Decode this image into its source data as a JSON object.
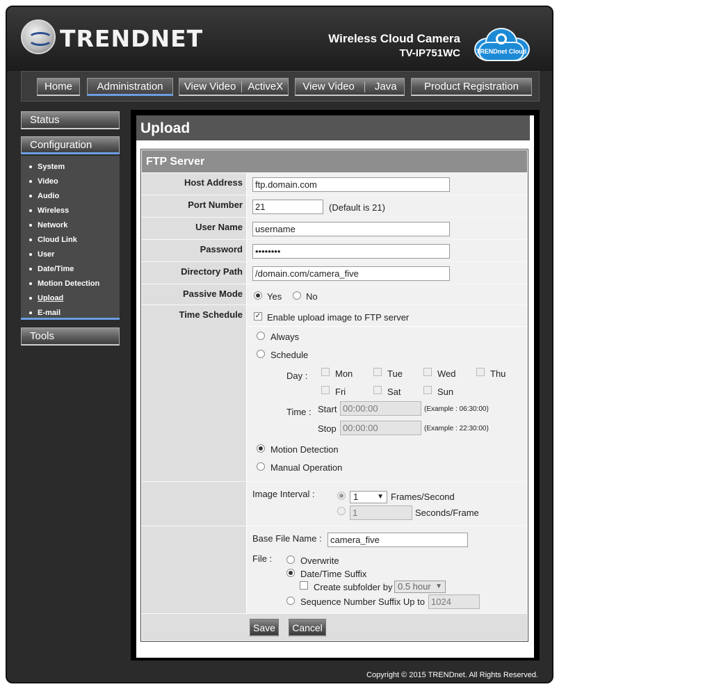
{
  "brand": {
    "logo_text": "TRENDNET",
    "product_name": "Wireless Cloud Camera",
    "model": "TV-IP751WC",
    "cloud_label": "TRENDnet Cloud"
  },
  "nav": {
    "home": "Home",
    "administration": "Administration",
    "view_video_activex_a": "View Video",
    "view_video_activex_b": "ActiveX",
    "view_video_java_a": "View Video",
    "view_video_java_b": "Java",
    "product_registration": "Product Registration"
  },
  "sidebar": {
    "status": "Status",
    "configuration": "Configuration",
    "items": [
      "System",
      "Video",
      "Audio",
      "Wireless",
      "Network",
      "Cloud Link",
      "User",
      "Date/Time",
      "Motion Detection",
      "Upload",
      "E-mail"
    ],
    "tools": "Tools"
  },
  "page": {
    "title": "Upload",
    "section": "FTP Server"
  },
  "form": {
    "host_label": "Host Address",
    "host_value": "ftp.domain.com",
    "port_label": "Port Number",
    "port_value": "21",
    "port_hint": "(Default is 21)",
    "user_label": "User Name",
    "user_value": "username",
    "password_label": "Password",
    "password_value": "••••••••",
    "dir_label": "Directory Path",
    "dir_value": "/domain.com/camera_five",
    "passive_label": "Passive Mode",
    "passive_yes": "Yes",
    "passive_no": "No",
    "schedule_label": "Time Schedule",
    "enable_upload": "Enable upload image to FTP server",
    "always": "Always",
    "schedule": "Schedule",
    "day_label": "Day :",
    "days": [
      "Mon",
      "Tue",
      "Wed",
      "Thu",
      "Fri",
      "Sat",
      "Sun"
    ],
    "time_label": "Time :",
    "start_label": "Start",
    "start_value": "00:00:00",
    "start_example": "(Example : 06:30:00)",
    "stop_label": "Stop",
    "stop_value": "00:00:00",
    "stop_example": "(Example : 22:30:00)",
    "motion_detection": "Motion Detection",
    "manual_operation": "Manual Operation",
    "interval_label": "Image Interval :",
    "fps_value": "1",
    "fps_unit": "Frames/Second",
    "spf_value": "1",
    "spf_unit": "Seconds/Frame",
    "base_label": "Base File Name :",
    "base_value": "camera_five",
    "file_label": "File :",
    "overwrite": "Overwrite",
    "datetime_suffix": "Date/Time Suffix",
    "subfolder": "Create subfolder by",
    "subfolder_value": "0.5 hour",
    "sequence": "Sequence Number Suffix Up to",
    "sequence_value": "1024"
  },
  "buttons": {
    "save": "Save",
    "cancel": "Cancel"
  },
  "footer": "Copyright © 2015 TRENDnet.  All Rights Reserved."
}
